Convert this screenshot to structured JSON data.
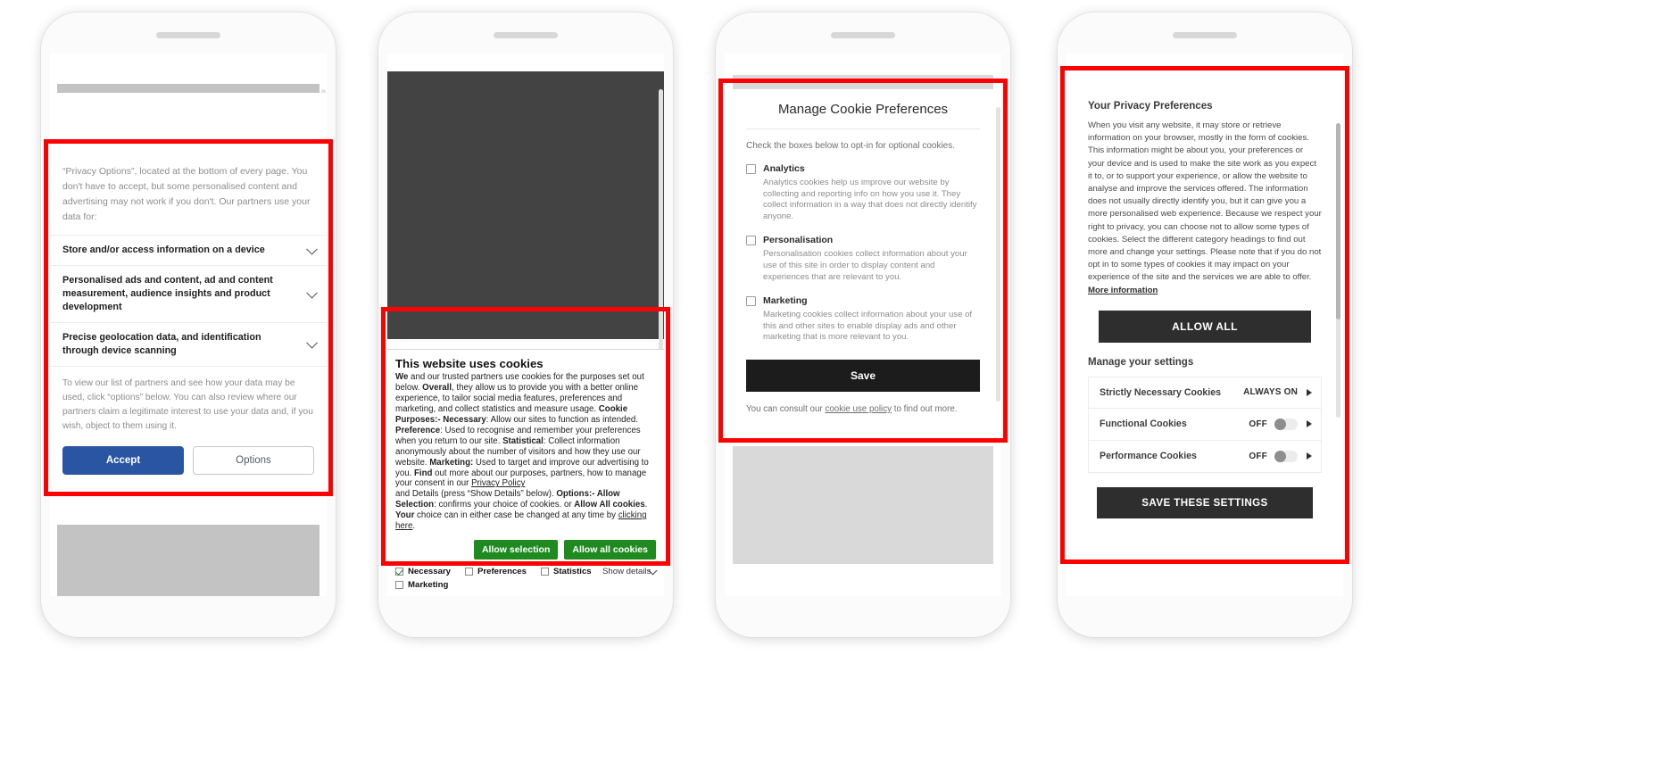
{
  "colors": {
    "annotation": "#ff0000",
    "accept_blue": "#2a55a3",
    "green": "#1f8a1f",
    "dark": "#1c1c1c"
  },
  "phone1": {
    "name": "TCF consent banner",
    "intro": "“Privacy Options”, located at the bottom of every page. You don't have to accept, but some personalised content and advertising may not work if you don't. Our partners use your data for:",
    "purposes": [
      "Store and/or access information on a device",
      "Personalised ads and content, ad and content measurement, audience insights and product development",
      "Precise geolocation data, and identification through device scanning"
    ],
    "note": "To view our list of partners and see how your data may be used, click “options” below. You can also review where our partners claim a legitimate interest to use your data and, if you wish, object to them using it.",
    "accept_label": "Accept",
    "options_label": "Options",
    "chevron_icon": "chevron-down-icon"
  },
  "phone2": {
    "name": "This website uses cookies banner",
    "title": "This website uses cookies",
    "body_html": "<b>We</b> and our trusted partners use cookies for the purposes set out below. <b>Overall</b>, they allow us to provide you with a better online experience, to tailor social media features, preferences and marketing, and collect statistics and measure usage. <b>Cookie Purposes:- Necessary</b>: Allow our sites to function as intended. <b>Preference</b>: Used to recognise and remember your preferences when you return to our site. <b>Statistical</b>: Collect information anonymously about the number of visitors and how they use our website. <b>Marketing:</b> Used to target and improve our advertising to you. <b>Find</b> out more about our purposes, partners, how to manage your consent in our <a href=\"#\">Privacy Policy</a><br>and Details (press “Show Details” below). <b>Options:- Allow Selection</b>: confirms your choice of cookies. or <b>Allow All cookies</b>. <b>Your</b> choice can in either case be changed at any time by <a href=\"#\">clicking here</a>.",
    "allow_selection_label": "Allow selection",
    "allow_all_label": "Allow all cookies",
    "checkboxes": [
      {
        "label": "Necessary",
        "checked": true
      },
      {
        "label": "Preferences",
        "checked": false
      },
      {
        "label": "Statistics",
        "checked": false
      },
      {
        "label": "Marketing",
        "checked": false
      }
    ],
    "show_details_label": "Show details",
    "show_details_icon": "chevron-down-icon"
  },
  "phone3": {
    "name": "Manage Cookie Preferences modal",
    "title": "Manage Cookie Preferences",
    "subtitle": "Check the boxes below to opt-in for optional cookies.",
    "items": [
      {
        "label": "Analytics",
        "checked": false,
        "desc": "Analytics cookies help us improve our website by collecting and reporting info on how you use it. They collect information in a way that does not directly identify anyone."
      },
      {
        "label": "Personalisation",
        "checked": false,
        "desc": "Personalisation cookies collect information about your use of this site in order to display content and experiences that are relevant to you."
      },
      {
        "label": "Marketing",
        "checked": false,
        "desc": "Marketing cookies collect information about your use of this and other sites to enable display ads and other marketing that is more relevant to you."
      }
    ],
    "save_label": "Save",
    "footer_prefix": "You can consult our ",
    "footer_link": "cookie use policy",
    "footer_suffix": " to find out more."
  },
  "phone4": {
    "name": "Your Privacy Preferences panel",
    "title": "Your Privacy Preferences",
    "body": "When you visit any website, it may store or retrieve information on your browser, mostly in the form of cookies. This information might be about you, your preferences or your device and is used to make the site work as you expect it to, or to support your experience, or allow the website to analyse and improve the services offered. The information does not usually directly identify you, but it can give you a more personalised web experience. Because we respect your right to privacy, you can choose not to allow some types of cookies. Select the different category headings to find out more and change your settings. Please note that if you do not opt in to some types of cookies it may impact on your experience of the site and the services we are able to offer. ",
    "more_info_label": "More information",
    "allow_all_label": "ALLOW ALL",
    "manage_heading": "Manage your settings",
    "rows": [
      {
        "label": "Strictly Necessary Cookies",
        "state": "ALWAYS ON",
        "toggle": false
      },
      {
        "label": "Functional Cookies",
        "state": "OFF",
        "toggle": true
      },
      {
        "label": "Performance Cookies",
        "state": "OFF",
        "toggle": true
      }
    ],
    "save_label": "SAVE THESE SETTINGS",
    "arrow_icon": "chevron-right-icon"
  }
}
